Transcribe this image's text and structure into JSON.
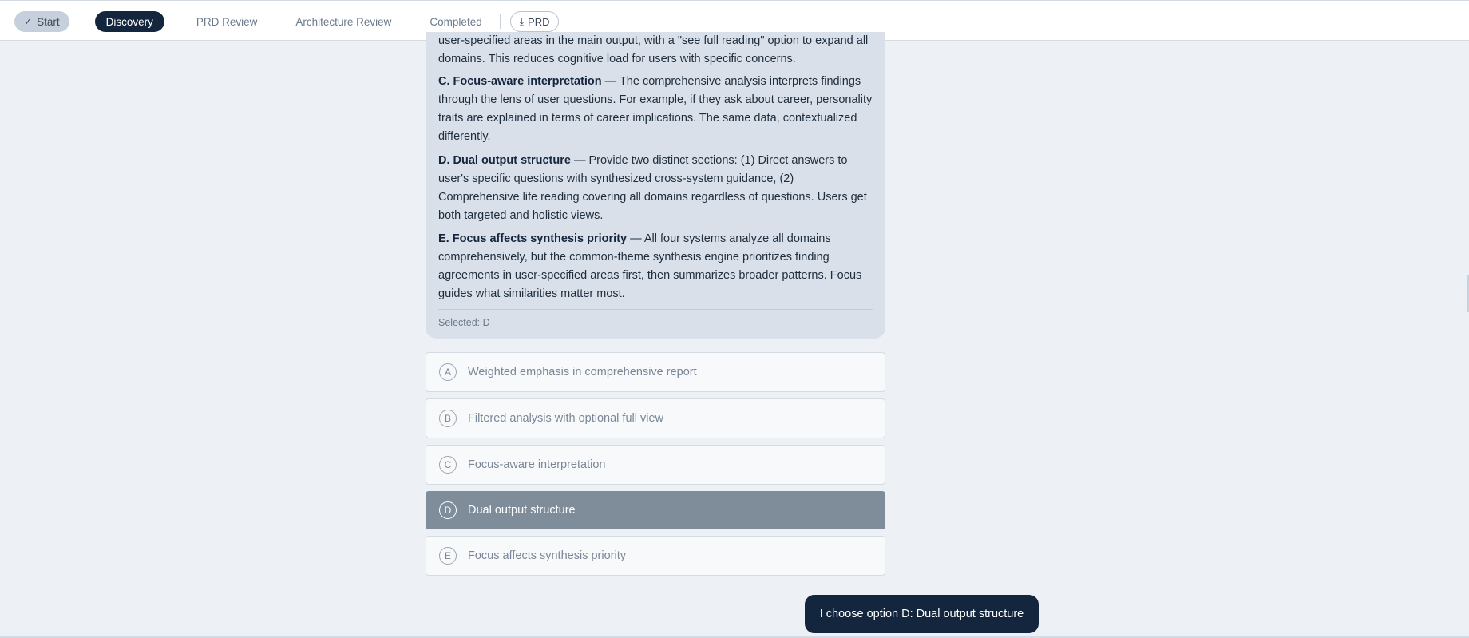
{
  "header": {
    "steps": [
      {
        "label": "Start",
        "state": "done",
        "icon": "check-icon"
      },
      {
        "label": "Discovery",
        "state": "active"
      },
      {
        "label": "PRD Review",
        "state": "pending"
      },
      {
        "label": "Architecture Review",
        "state": "pending"
      },
      {
        "label": "Completed",
        "state": "pending"
      }
    ],
    "prd_button": {
      "label": "PRD",
      "icon": "download-icon"
    }
  },
  "message": {
    "paragraphs": [
      {
        "title": "",
        "text": "user-specified areas in the main output, with a \"see full reading\" option to expand all domains. This reduces cognitive load for users with specific concerns."
      },
      {
        "title": "C. Focus-aware interpretation",
        "text": " — The comprehensive analysis interprets findings through the lens of user questions. For example, if they ask about career, personality traits are explained in terms of career implications. The same data, contextualized differently."
      },
      {
        "title": "D. Dual output structure",
        "text": " — Provide two distinct sections: (1) Direct answers to user's specific questions with synthesized cross-system guidance, (2) Comprehensive life reading covering all domains regardless of questions. Users get both targeted and holistic views."
      },
      {
        "title": "E. Focus affects synthesis priority",
        "text": " — All four systems analyze all domains comprehensively, but the common-theme synthesis engine prioritizes finding agreements in user-specified areas first, then summarizes broader patterns. Focus guides what similarities matter most."
      }
    ],
    "selected_text": "Selected: D"
  },
  "options": [
    {
      "letter": "A",
      "label": "Weighted emphasis in comprehensive report",
      "selected": false
    },
    {
      "letter": "B",
      "label": "Filtered analysis with optional full view",
      "selected": false
    },
    {
      "letter": "C",
      "label": "Focus-aware interpretation",
      "selected": false
    },
    {
      "letter": "D",
      "label": "Dual output structure",
      "selected": true
    },
    {
      "letter": "E",
      "label": "Focus affects synthesis priority",
      "selected": false
    }
  ],
  "user_message": "I choose option D: Dual output structure",
  "colors": {
    "primary_dark": "#14263d",
    "bubble_bg": "#d9e0ea",
    "selected_option_bg": "#7f8c9a",
    "page_bg": "#edf1f6"
  }
}
